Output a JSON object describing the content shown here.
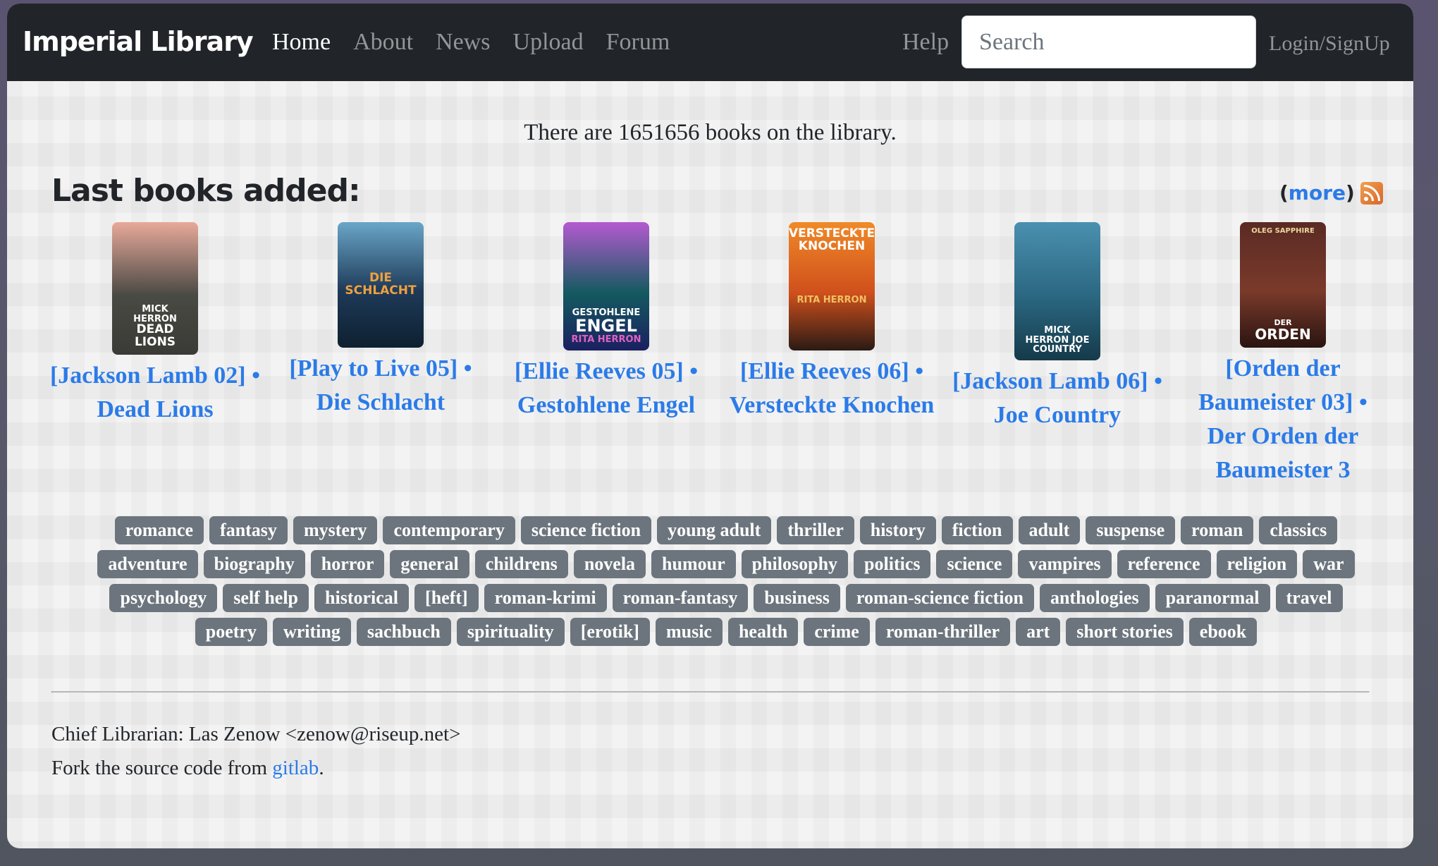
{
  "navbar": {
    "brand": "Imperial Library",
    "links": [
      {
        "label": "Home",
        "active": true
      },
      {
        "label": "About",
        "active": false
      },
      {
        "label": "News",
        "active": false
      },
      {
        "label": "Upload",
        "active": false
      },
      {
        "label": "Forum",
        "active": false
      }
    ],
    "help_label": "Help",
    "search": {
      "placeholder": "Search",
      "value": ""
    },
    "login_label": "Login/SignUp"
  },
  "main": {
    "count_text": "There are 1651656 books on the library.",
    "book_count": 1651656,
    "section_title": "Last books added:",
    "more_open": "(",
    "more_label": "more",
    "more_close": ")",
    "rss_icon": "rss-feed-icon",
    "books": [
      {
        "title": "[Jackson Lamb 02] • Dead Lions",
        "cover_lines": [
          "MICK",
          "HERRON",
          "DEAD",
          "LIONS"
        ],
        "cover_colors": [
          "#e8a99a",
          "#4a4a44",
          "#3a3a36"
        ]
      },
      {
        "title": "[Play to Live 05] • Die Schlacht",
        "cover_lines": [
          "DIE",
          "SCHLACHT"
        ],
        "cover_colors": [
          "#6aa6c8",
          "#1e3a58",
          "#0e2030"
        ]
      },
      {
        "title": "[Ellie Reeves 05] • Gestohlene Engel",
        "cover_lines": [
          "GESTOHLENE",
          "ENGEL",
          "RITA HERRON"
        ],
        "cover_colors": [
          "#b45ad0",
          "#145a60",
          "#1a2060"
        ]
      },
      {
        "title": "[Ellie Reeves 06] • Versteckte Knochen",
        "cover_lines": [
          "VERSTECKTE",
          "KNOCHEN",
          "RITA HERRON"
        ],
        "cover_colors": [
          "#f08a28",
          "#d0501c",
          "#2a1a14"
        ]
      },
      {
        "title": "[Jackson Lamb 06] • Joe Country",
        "cover_lines": [
          "MICK",
          "HERRON JOE",
          "COUNTRY"
        ],
        "cover_colors": [
          "#4a90b0",
          "#2a6680",
          "#153a4a"
        ]
      },
      {
        "title": "[Orden der Baumeister 03] • Der Orden der Baumeister 3",
        "cover_lines": [
          "OLEG SAPPHIRE",
          "DER",
          "ORDEN"
        ],
        "cover_colors": [
          "#5a2a24",
          "#7a3a2a",
          "#2a1410"
        ]
      }
    ]
  },
  "tags": [
    "romance",
    "fantasy",
    "mystery",
    "contemporary",
    "science fiction",
    "young adult",
    "thriller",
    "history",
    "fiction",
    "adult",
    "suspense",
    "roman",
    "classics",
    "adventure",
    "biography",
    "horror",
    "general",
    "childrens",
    "novela",
    "humour",
    "philosophy",
    "politics",
    "science",
    "vampires",
    "reference",
    "religion",
    "war",
    "psychology",
    "self help",
    "historical",
    "[heft]",
    "roman-krimi",
    "roman-fantasy",
    "business",
    "roman-science fiction",
    "anthologies",
    "paranormal",
    "travel",
    "poetry",
    "writing",
    "sachbuch",
    "spirituality",
    "[erotik]",
    "music",
    "health",
    "crime",
    "roman-thriller",
    "art",
    "short stories",
    "ebook"
  ],
  "tag_rows": [
    13,
    14,
    11,
    12
  ],
  "footer": {
    "librarian_text": "Chief Librarian: Las Zenow <zenow@riseup.net>",
    "fork_prefix": "Fork the source code from ",
    "fork_link": "gitlab",
    "fork_suffix": "."
  },
  "colors": {
    "navbar_bg": "#212529",
    "link": "#2b7be8",
    "tag_bg": "#6c757d",
    "rss": "#e8782e"
  }
}
